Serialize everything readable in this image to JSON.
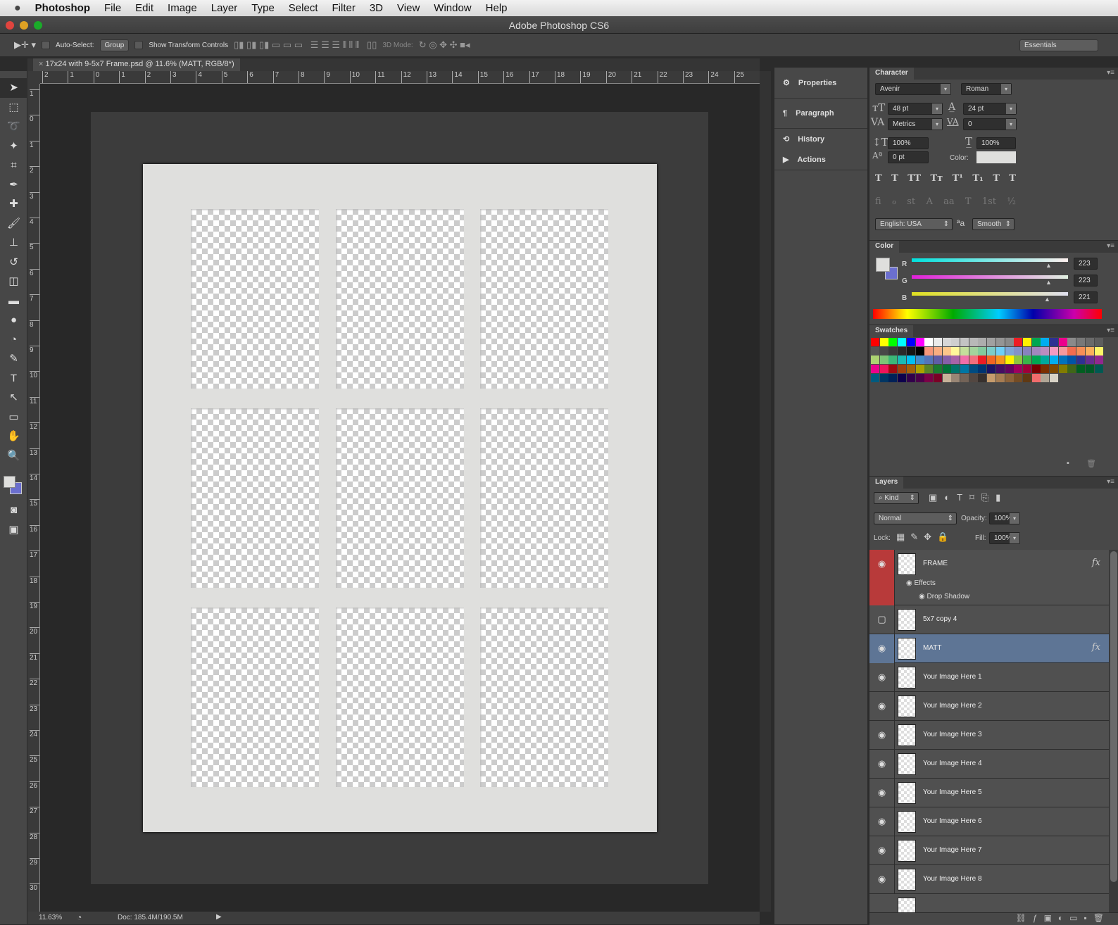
{
  "menubar": {
    "apple": "",
    "items": [
      "Photoshop",
      "File",
      "Edit",
      "Image",
      "Layer",
      "Type",
      "Select",
      "Filter",
      "3D",
      "View",
      "Window",
      "Help"
    ]
  },
  "window": {
    "title": "Adobe Photoshop CS6"
  },
  "options": {
    "auto_select": "Auto-Select:",
    "group": "Group",
    "show_transform": "Show Transform Controls",
    "mode_3d": "3D Mode:",
    "workspace": "Essentials"
  },
  "document": {
    "tab": "17x24 with 9-5x7 Frame.psd @ 11.6% (MATT, RGB/8*)",
    "zoom": "11.63%",
    "doc_size": "Doc: 185.4M/190.5M"
  },
  "rulers": {
    "h": [
      "2",
      "1",
      "0",
      "1",
      "2",
      "3",
      "4",
      "5",
      "6",
      "7",
      "8",
      "9",
      "10",
      "11",
      "12",
      "13",
      "14",
      "15",
      "16",
      "17",
      "18",
      "19",
      "20",
      "21",
      "22",
      "23",
      "24",
      "25"
    ],
    "v": [
      "1",
      "0",
      "1",
      "2",
      "3",
      "4",
      "5",
      "6",
      "7",
      "8",
      "9",
      "10",
      "11",
      "12",
      "13",
      "14",
      "15",
      "16",
      "17",
      "18",
      "19",
      "20",
      "21",
      "22",
      "23",
      "24",
      "25",
      "26",
      "27",
      "28",
      "29",
      "30"
    ]
  },
  "tools": [
    "move",
    "marquee",
    "lasso",
    "magic-wand",
    "crop",
    "eyedropper",
    "healing",
    "brush",
    "stamp",
    "history-brush",
    "eraser",
    "gradient",
    "blur",
    "dodge",
    "pen",
    "type",
    "path-select",
    "shape",
    "hand",
    "zoom"
  ],
  "dock": [
    {
      "label": "Properties",
      "icon": "properties-icon"
    },
    {
      "label": "Paragraph",
      "icon": "paragraph-icon"
    },
    {
      "label": "History",
      "icon": "history-icon"
    },
    {
      "label": "Actions",
      "icon": "actions-icon"
    }
  ],
  "character": {
    "title": "Character",
    "font": "Avenir",
    "style": "Roman",
    "size": "48 pt",
    "leading": "24 pt",
    "kerning": "Metrics",
    "tracking": "0",
    "vscale": "100%",
    "hscale": "100%",
    "baseline": "0 pt",
    "color_label": "Color:",
    "language": "English: USA",
    "aa": "Smooth",
    "aa_icon": "ªa",
    "type_buttons": [
      "T",
      "T",
      "TT",
      "Tт",
      "T¹",
      "T₁",
      "T",
      "T"
    ],
    "ot_buttons": [
      "ﬁ",
      "ℴ",
      "st",
      "A",
      "aa",
      "T",
      "1st",
      "½"
    ]
  },
  "color": {
    "title": "Color",
    "r_label": "R",
    "g_label": "G",
    "b_label": "B",
    "r": "223",
    "g": "223",
    "b": "221",
    "fg": "#dfdfdd",
    "bg": "#6b6fcf"
  },
  "swatches": {
    "title": "Swatches",
    "rows": [
      [
        "#ff0000",
        "#ffff00",
        "#00ff00",
        "#00ffff",
        "#0000ff",
        "#ff00ff",
        "#ffffff",
        "#ebebeb",
        "#d7d7d7",
        "#cfcfcf",
        "#c3c3c3",
        "#b8b8b8",
        "#adadad",
        "#a1a1a1",
        "#959595",
        "#8a8a8a",
        "#ee1d24",
        "#fff200",
        "#00a650",
        "#00adef",
        "#2e3192",
        "#ec008c",
        "#8a8a8a",
        "#787878",
        "#6a6a6a",
        "#5e5e5e"
      ],
      [
        "#555555",
        "#484848",
        "#3a3a3a",
        "#2a2a2a",
        "#161616",
        "#000000",
        "#f7977a",
        "#f9ad81",
        "#fdc68a",
        "#fff79a",
        "#c4df9b",
        "#a3d39c",
        "#82ca9d",
        "#7bcdc8",
        "#6ecff6",
        "#7ea7d8",
        "#8493ca",
        "#8882be",
        "#a187be",
        "#bc8cbf",
        "#f49ac2",
        "#f6989d",
        "#f26c4f",
        "#f68e56",
        "#fbaf5c",
        "#fff467"
      ],
      [
        "#acd372",
        "#7cc576",
        "#3bb878",
        "#1abbb4",
        "#00bff3",
        "#438ccb",
        "#5574b9",
        "#605ca8",
        "#855fa8",
        "#a763a8",
        "#f06ea9",
        "#f26d7d",
        "#ed1c24",
        "#f26522",
        "#f7941d",
        "#fff200",
        "#8dc63f",
        "#39b54a",
        "#00a651",
        "#00a99d",
        "#00aeef",
        "#0072bc",
        "#0054a6",
        "#2e3192",
        "#662d91",
        "#92278f"
      ],
      [
        "#ec008c",
        "#ed145b",
        "#9e0b0f",
        "#a0410d",
        "#a36209",
        "#aba000",
        "#598527",
        "#1a7b30",
        "#007236",
        "#00746b",
        "#0076a3",
        "#004b80",
        "#003471",
        "#1b1464",
        "#440e62",
        "#630460",
        "#9e005d",
        "#9e0039",
        "#790000",
        "#7b2e00",
        "#7d4900",
        "#827b00",
        "#406618",
        "#005e20",
        "#005826",
        "#005952"
      ],
      [
        "#005b7f",
        "#003663",
        "#002157",
        "#0d004c",
        "#32004b",
        "#4b0049",
        "#7b0046",
        "#7a0026",
        "#c7b299",
        "#998675",
        "#736357",
        "#534741",
        "#37302d",
        "#c69c6d",
        "#a67c52",
        "#8c6239",
        "#754c24",
        "#603913",
        "#f26c6c",
        "#b0a595",
        "#d8d3c6"
      ]
    ]
  },
  "layers": {
    "title": "Layers",
    "kind": "Kind",
    "blend": "Normal",
    "opacity_label": "Opacity:",
    "opacity": "100%",
    "lock_label": "Lock:",
    "fill_label": "Fill:",
    "fill": "100%",
    "effects": "Effects",
    "drop_shadow": "Drop Shadow",
    "items": [
      {
        "name": "FRAME",
        "visible": true,
        "fx": "fx"
      },
      {
        "name": "5x7 copy 4",
        "visible": false
      },
      {
        "name": "MATT",
        "visible": true,
        "fx": "fx",
        "selected": true
      },
      {
        "name": "Your Image Here 1",
        "visible": true
      },
      {
        "name": "Your Image Here 2",
        "visible": true
      },
      {
        "name": "Your Image Here 3",
        "visible": true
      },
      {
        "name": "Your Image Here 4",
        "visible": true
      },
      {
        "name": "Your Image Here 5",
        "visible": true
      },
      {
        "name": "Your Image Here 6",
        "visible": true
      },
      {
        "name": "Your Image Here 7",
        "visible": true
      },
      {
        "name": "Your Image Here 8",
        "visible": true
      }
    ]
  }
}
